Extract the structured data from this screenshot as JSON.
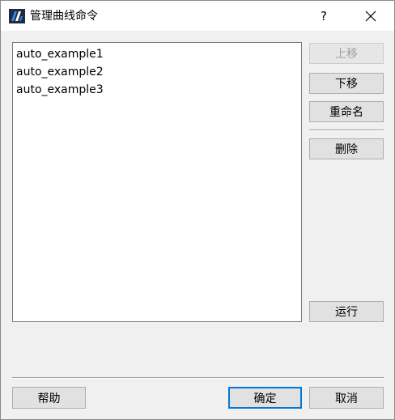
{
  "window": {
    "title": "管理曲线命令",
    "help_glyph": "?",
    "app_icon": "app-logo-icon",
    "close_icon": "close-icon"
  },
  "list": {
    "items": [
      "auto_example1",
      "auto_example2",
      "auto_example3"
    ]
  },
  "side_buttons": {
    "move_up": "上移",
    "move_down": "下移",
    "rename": "重命名",
    "delete": "删除",
    "run": "运行"
  },
  "bottom_buttons": {
    "help": "帮助",
    "ok": "确定",
    "cancel": "取消"
  },
  "colors": {
    "accent": "#0078d7",
    "icon_dark": "#1f2a44",
    "icon_blue": "#2f8ed8"
  }
}
